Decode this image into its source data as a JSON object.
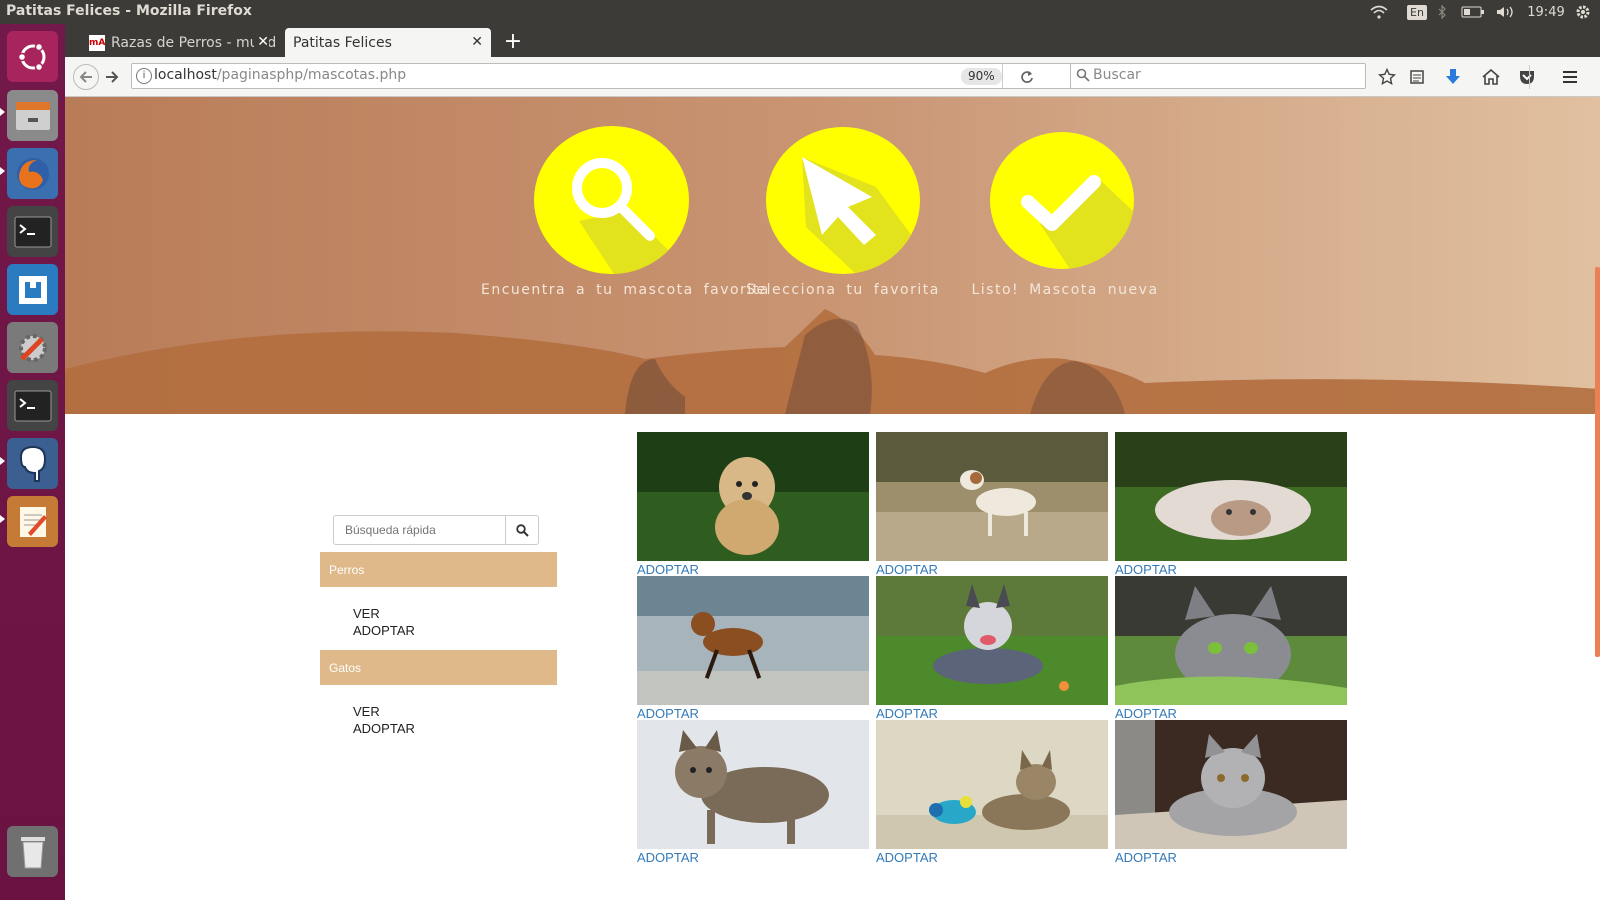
{
  "os": {
    "window_title": "Patitas Felices - Mozilla Firefox",
    "keyboard": "En",
    "clock": "19:49"
  },
  "browser": {
    "tabs": [
      {
        "label": "Razas de Perros - mund"
      },
      {
        "label": "Patitas Felices"
      }
    ],
    "new_tab": "+",
    "url_host": "localhost",
    "url_path": "/paginasphp/mascotas.php",
    "zoom": "90%",
    "search_placeholder": "Buscar"
  },
  "hero": {
    "steps": [
      {
        "caption": "Encuentra a tu mascota favorita",
        "icon": "search-icon"
      },
      {
        "caption": "Selecciona tu favorita",
        "icon": "cursor-icon"
      },
      {
        "caption": "Listo! Mascota nueva",
        "icon": "check-icon"
      }
    ]
  },
  "sidebar": {
    "search_placeholder": "Búsqueda rápida",
    "categories": [
      {
        "title": "Perros",
        "links": [
          "VER",
          "ADOPTAR"
        ]
      },
      {
        "title": "Gatos",
        "links": [
          "VER",
          "ADOPTAR"
        ]
      }
    ]
  },
  "gallery": {
    "adopt_label": "ADOPTAR",
    "items": [
      {
        "alt": "golden puppy running on grass"
      },
      {
        "alt": "terrier standing in water"
      },
      {
        "alt": "bulldog lying on grass"
      },
      {
        "alt": "airedale running on beach"
      },
      {
        "alt": "cattle dog lying on lawn"
      },
      {
        "alt": "grey cat on green blanket"
      },
      {
        "alt": "maine coon cat standing"
      },
      {
        "alt": "tabby kitten playing with toy"
      },
      {
        "alt": "silver british shorthair cat"
      }
    ]
  },
  "colors": {
    "accent": "#ffff00",
    "sidebar_header": "#dfb98a",
    "link": "#337ab7",
    "launcher": "#6e1646"
  }
}
